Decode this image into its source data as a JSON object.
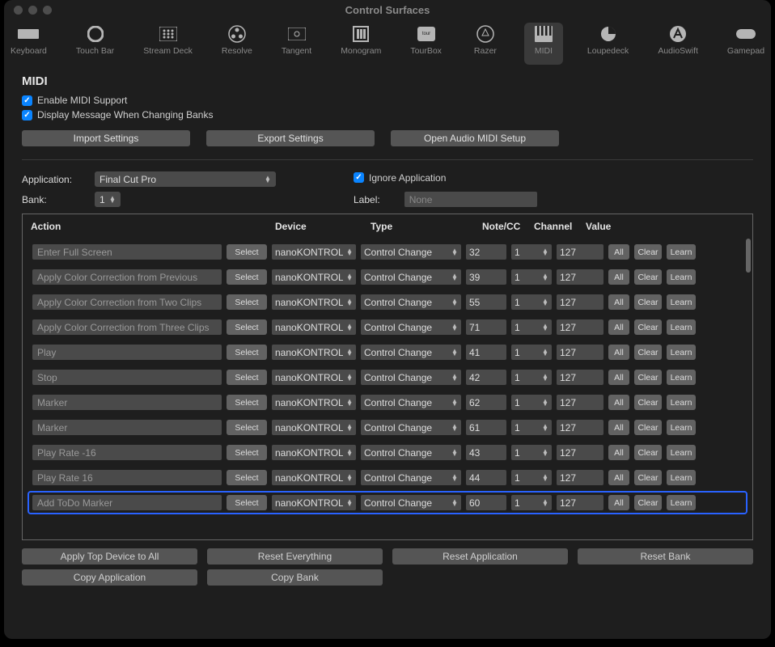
{
  "window_title": "Control Surfaces",
  "toolbar_items": [
    {
      "id": "keyboard",
      "label": "Keyboard"
    },
    {
      "id": "touchbar",
      "label": "Touch Bar"
    },
    {
      "id": "streamdeck",
      "label": "Stream Deck"
    },
    {
      "id": "resolve",
      "label": "Resolve"
    },
    {
      "id": "tangent",
      "label": "Tangent"
    },
    {
      "id": "monogram",
      "label": "Monogram"
    },
    {
      "id": "tourbox",
      "label": "TourBox"
    },
    {
      "id": "razer",
      "label": "Razer"
    },
    {
      "id": "midi",
      "label": "MIDI",
      "active": true
    },
    {
      "id": "loupedeck",
      "label": "Loupedeck"
    },
    {
      "id": "audioswift",
      "label": "AudioSwift"
    },
    {
      "id": "gamepad",
      "label": "Gamepad"
    }
  ],
  "section_title": "MIDI",
  "checkbox1": {
    "label": "Enable MIDI Support",
    "checked": true
  },
  "checkbox2": {
    "label": "Display Message When Changing Banks",
    "checked": true
  },
  "buttons": {
    "import": "Import Settings",
    "export": "Export Settings",
    "open_audio": "Open Audio MIDI Setup"
  },
  "application_label": "Application:",
  "application_value": "Final Cut Pro",
  "ignore_app": {
    "label": "Ignore Application",
    "checked": true
  },
  "bank_label": "Bank:",
  "bank_value": "1",
  "label_label": "Label:",
  "label_value": "None",
  "columns": {
    "action": "Action",
    "device": "Device",
    "type": "Type",
    "notecc": "Note/CC",
    "channel": "Channel",
    "value": "Value"
  },
  "row_buttons": {
    "select": "Select",
    "all": "All",
    "clear": "Clear",
    "learn": "Learn"
  },
  "rows": [
    {
      "action": "Enter Full Screen",
      "device": "nanoKONTROL",
      "type": "Control Change",
      "notecc": "32",
      "channel": "1",
      "value": "127"
    },
    {
      "action": "Apply Color Correction from Previous",
      "device": "nanoKONTROL",
      "type": "Control Change",
      "notecc": "39",
      "channel": "1",
      "value": "127"
    },
    {
      "action": "Apply Color Correction from Two Clips",
      "device": "nanoKONTROL",
      "type": "Control Change",
      "notecc": "55",
      "channel": "1",
      "value": "127"
    },
    {
      "action": "Apply Color Correction from Three Clips",
      "device": "nanoKONTROL",
      "type": "Control Change",
      "notecc": "71",
      "channel": "1",
      "value": "127"
    },
    {
      "action": "Play",
      "device": "nanoKONTROL",
      "type": "Control Change",
      "notecc": "41",
      "channel": "1",
      "value": "127"
    },
    {
      "action": "Stop",
      "device": "nanoKONTROL",
      "type": "Control Change",
      "notecc": "42",
      "channel": "1",
      "value": "127"
    },
    {
      "action": "Marker",
      "device": "nanoKONTROL",
      "type": "Control Change",
      "notecc": "62",
      "channel": "1",
      "value": "127"
    },
    {
      "action": "Marker",
      "device": "nanoKONTROL",
      "type": "Control Change",
      "notecc": "61",
      "channel": "1",
      "value": "127"
    },
    {
      "action": "Play Rate -16",
      "device": "nanoKONTROL",
      "type": "Control Change",
      "notecc": "43",
      "channel": "1",
      "value": "127"
    },
    {
      "action": "Play Rate 16",
      "device": "nanoKONTROL",
      "type": "Control Change",
      "notecc": "44",
      "channel": "1",
      "value": "127"
    },
    {
      "action": "Add ToDo Marker",
      "device": "nanoKONTROL",
      "type": "Control Change",
      "notecc": "60",
      "channel": "1",
      "value": "127",
      "selected": true
    }
  ],
  "footer": {
    "apply_top": "Apply Top Device to All",
    "reset_everything": "Reset Everything",
    "reset_application": "Reset Application",
    "reset_bank": "Reset Bank",
    "copy_app": "Copy Application",
    "copy_bank": "Copy Bank"
  }
}
